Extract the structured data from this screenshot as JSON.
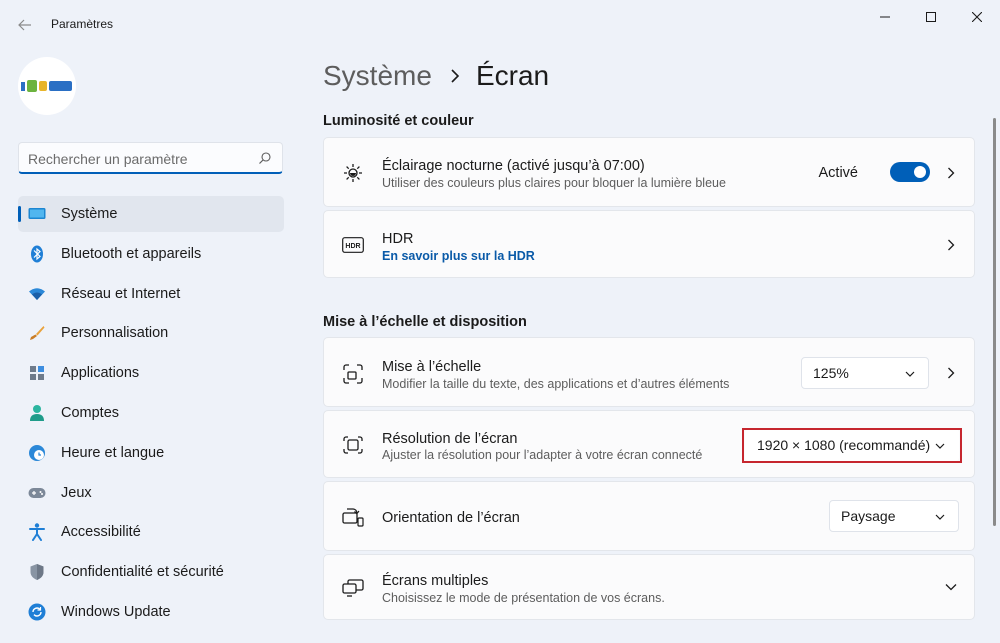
{
  "app": {
    "title": "Paramètres"
  },
  "search": {
    "placeholder": "Rechercher un paramètre"
  },
  "sidebar": {
    "items": [
      {
        "label": "Système",
        "icon": "monitor-icon",
        "selected": true
      },
      {
        "label": "Bluetooth et appareils",
        "icon": "bluetooth-icon"
      },
      {
        "label": "Réseau et Internet",
        "icon": "wifi-icon"
      },
      {
        "label": "Personnalisation",
        "icon": "brush-icon"
      },
      {
        "label": "Applications",
        "icon": "apps-icon"
      },
      {
        "label": "Comptes",
        "icon": "person-icon"
      },
      {
        "label": "Heure et langue",
        "icon": "globe-clock-icon"
      },
      {
        "label": "Jeux",
        "icon": "gamepad-icon"
      },
      {
        "label": "Accessibilité",
        "icon": "accessibility-icon"
      },
      {
        "label": "Confidentialité et sécurité",
        "icon": "shield-icon"
      },
      {
        "label": "Windows Update",
        "icon": "update-icon"
      }
    ]
  },
  "breadcrumb": {
    "parent": "Système",
    "current": "Écran"
  },
  "sections": {
    "brightness": "Luminosité et couleur",
    "scale": "Mise à l’échelle et disposition"
  },
  "night_light": {
    "title": "Éclairage nocturne (activé jusqu’à 07:00)",
    "subtitle": "Utiliser des couleurs plus claires pour bloquer la lumière bleue",
    "state": "Activé",
    "toggle_on": true
  },
  "hdr": {
    "title": "HDR",
    "link": "En savoir plus sur la HDR"
  },
  "scale": {
    "title": "Mise à l’échelle",
    "subtitle": "Modifier la taille du texte, des applications et d’autres éléments",
    "value": "125%"
  },
  "resolution": {
    "title": "Résolution de l’écran",
    "subtitle": "Ajuster la résolution pour l’adapter à  votre  écran connecté",
    "value": "1920 × 1080 (recommandé)"
  },
  "orientation": {
    "title": "Orientation de l’écran",
    "value": "Paysage"
  },
  "multi_display": {
    "title": "Écrans multiples",
    "subtitle": "Choisissez le mode de présentation de vos écrans."
  },
  "colors": {
    "accent": "#005fb8",
    "highlight": "#c6262e"
  }
}
